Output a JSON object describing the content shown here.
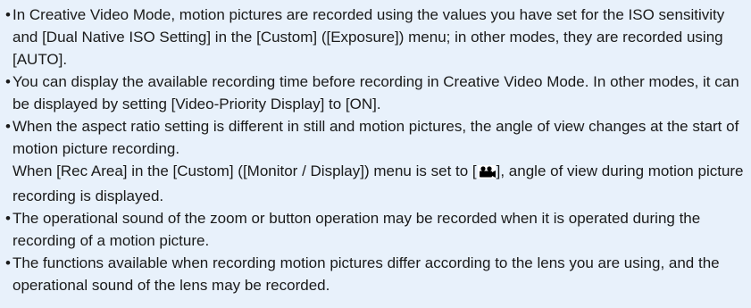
{
  "bullet_char": "•",
  "notes": [
    {
      "text": "In Creative Video Mode, motion pictures are recorded using the values you have set for the ISO sensitivity and [Dual Native ISO Setting] in the [Custom] ([Exposure]) menu; in other modes, they are recorded using [AUTO]."
    },
    {
      "text": "You can display the available recording time before recording in Creative Video Mode. In other modes, it can be displayed by setting [Video-Priority Display] to [ON]."
    },
    {
      "text": "When the aspect ratio setting is different in still and motion pictures, the angle of view changes at the start of motion picture recording.",
      "line2_before": "When [Rec Area] in the [Custom] ([Monitor / Display]) menu is set to [",
      "icon": "motion-picture-camera-icon",
      "line2_after": "], angle of view during motion picture recording is displayed."
    },
    {
      "text": "The operational sound of the zoom or button operation may be recorded when it is operated during the recording of a motion picture."
    },
    {
      "text": "The functions available when recording motion pictures differ according to the lens you are using, and the operational sound of the lens may be recorded."
    }
  ]
}
